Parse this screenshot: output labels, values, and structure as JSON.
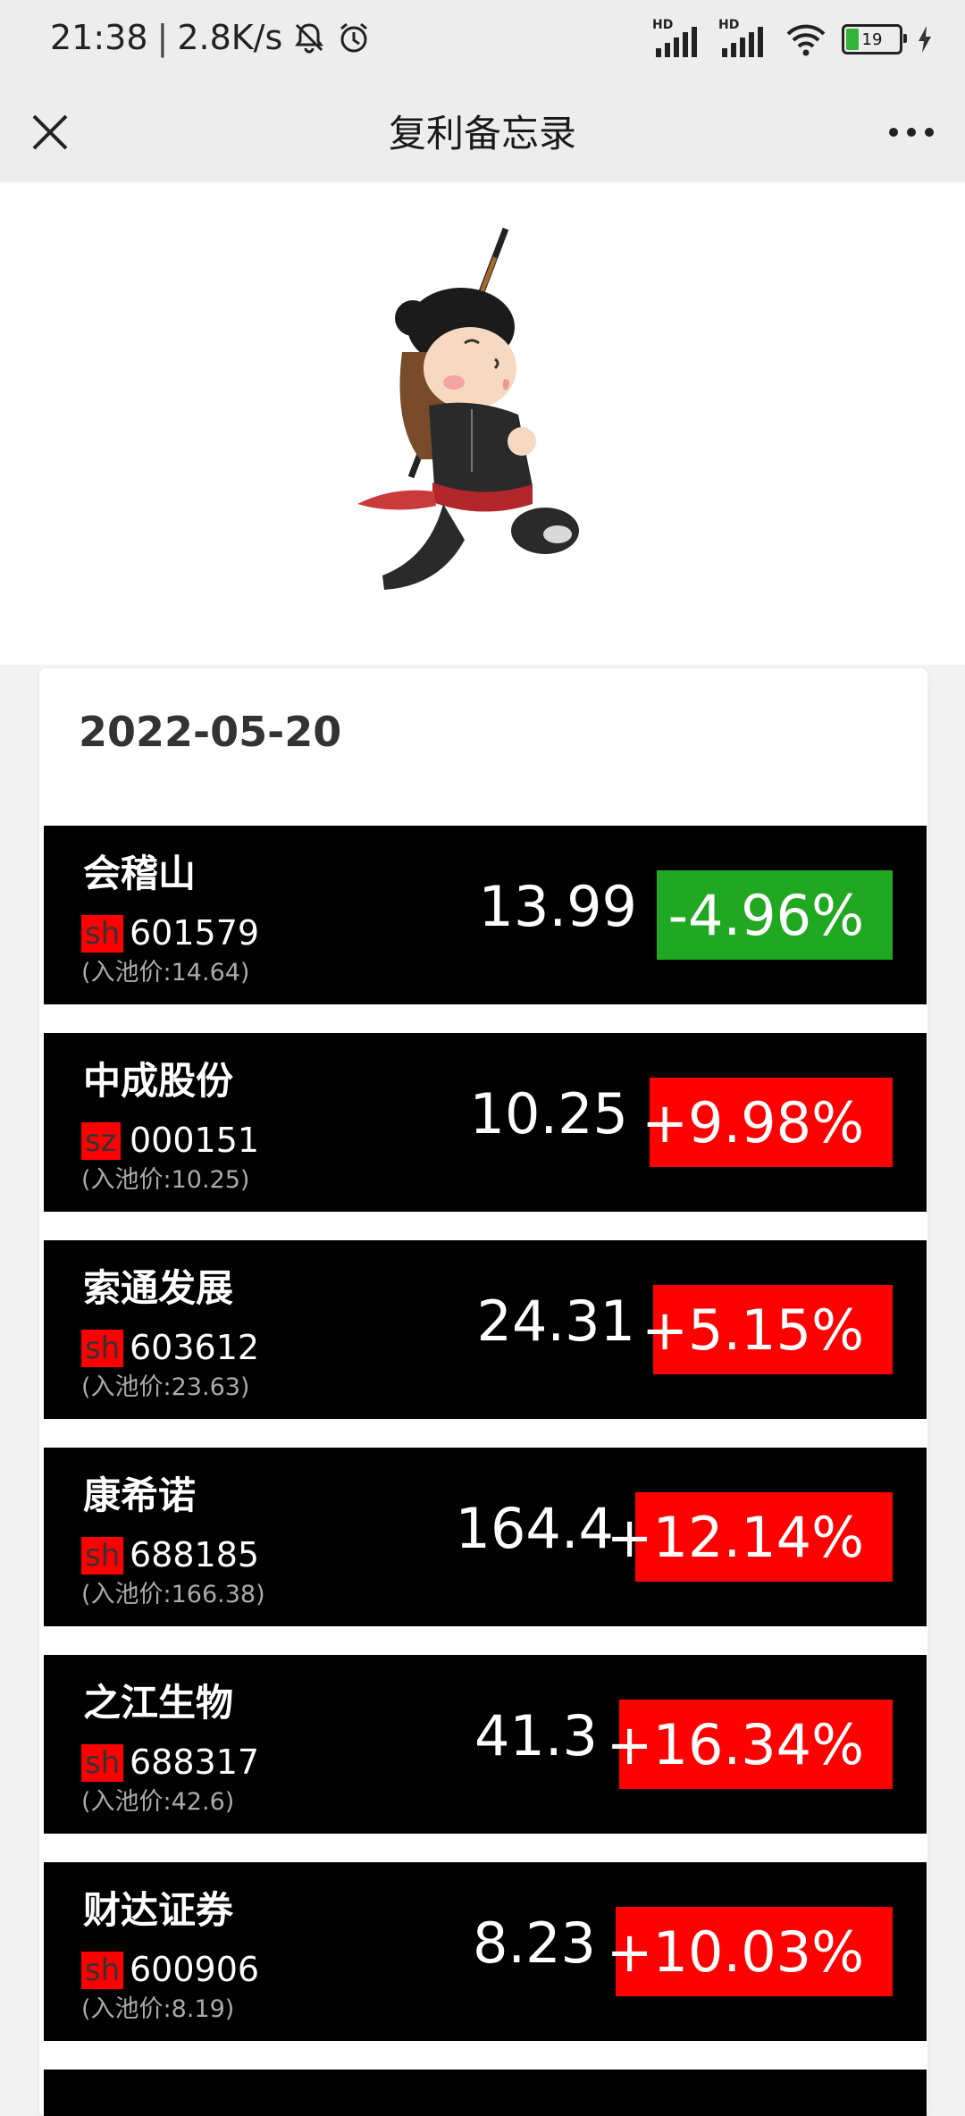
{
  "status": {
    "time": "21:38",
    "speed": "2.8K/s",
    "hd1": "HD",
    "hd2": "HD",
    "battery": "19"
  },
  "header": {
    "title": "复利备忘录"
  },
  "list": {
    "date": "2022-05-20",
    "stocks": [
      {
        "name": "会稽山",
        "market": "sh",
        "code": "601579",
        "entry": "(入池价:14.64)",
        "price": "13.99",
        "change": "-4.96%",
        "direction": "down"
      },
      {
        "name": "中成股份",
        "market": "sz",
        "code": "000151",
        "entry": "(入池价:10.25)",
        "price": "10.25",
        "change": "+9.98%",
        "direction": "up"
      },
      {
        "name": "索通发展",
        "market": "sh",
        "code": "603612",
        "entry": "(入池价:23.63)",
        "price": "24.31",
        "change": "+5.15%",
        "direction": "up"
      },
      {
        "name": "康希诺",
        "market": "sh",
        "code": "688185",
        "entry": "(入池价:166.38)",
        "price": "164.4",
        "change": "+12.14%",
        "direction": "up"
      },
      {
        "name": "之江生物",
        "market": "sh",
        "code": "688317",
        "entry": "(入池价:42.6)",
        "price": "41.3",
        "change": "+16.34%",
        "direction": "up"
      },
      {
        "name": "财达证券",
        "market": "sh",
        "code": "600906",
        "entry": "(入池价:8.19)",
        "price": "8.23",
        "change": "+10.03%",
        "direction": "up"
      }
    ]
  },
  "colors": {
    "up": "#ff0000",
    "down": "#21a822",
    "row_bg": "#000000"
  }
}
